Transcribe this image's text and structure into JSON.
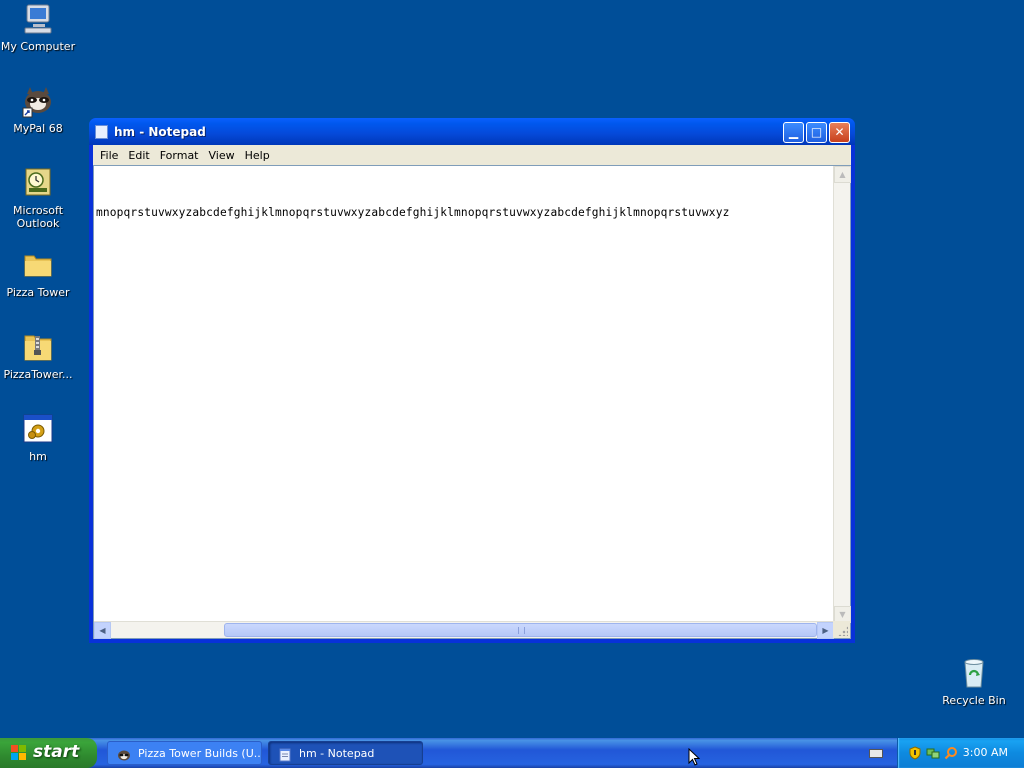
{
  "desktop": {
    "icons": [
      {
        "label": "My Computer",
        "icon": "my-computer-icon"
      },
      {
        "label": "MyPal 68",
        "icon": "mypal-browser-icon"
      },
      {
        "label": "Microsoft Outlook",
        "icon": "outlook-icon"
      },
      {
        "label": "Pizza Tower",
        "icon": "folder-icon"
      },
      {
        "label": "PizzaTower...",
        "icon": "zip-folder-icon"
      },
      {
        "label": "hm",
        "icon": "executable-icon"
      },
      {
        "label": "Recycle Bin",
        "icon": "recycle-bin-icon"
      }
    ]
  },
  "window": {
    "title": "hm - Notepad",
    "menu": [
      "File",
      "Edit",
      "Format",
      "View",
      "Help"
    ],
    "content": "mnopqrstuvwxyzabcdefghijklmnopqrstuvwxyzabcdefghijklmnopqrstuvwxyzabcdefghijklmnopqrstuvwxyz"
  },
  "taskbar": {
    "start_label": "start",
    "tasks": [
      {
        "label": "Pizza Tower Builds (U...",
        "icon": "mypal-browser-icon",
        "active": false
      },
      {
        "label": "hm - Notepad",
        "icon": "notepad-icon",
        "active": true
      }
    ],
    "clock": "3:00 AM"
  },
  "colors": {
    "desktop_bg": "#004e98",
    "taskbar_blue": "#245edb",
    "start_green": "#3a9a3a",
    "tray_blue": "#0f8fe4"
  }
}
